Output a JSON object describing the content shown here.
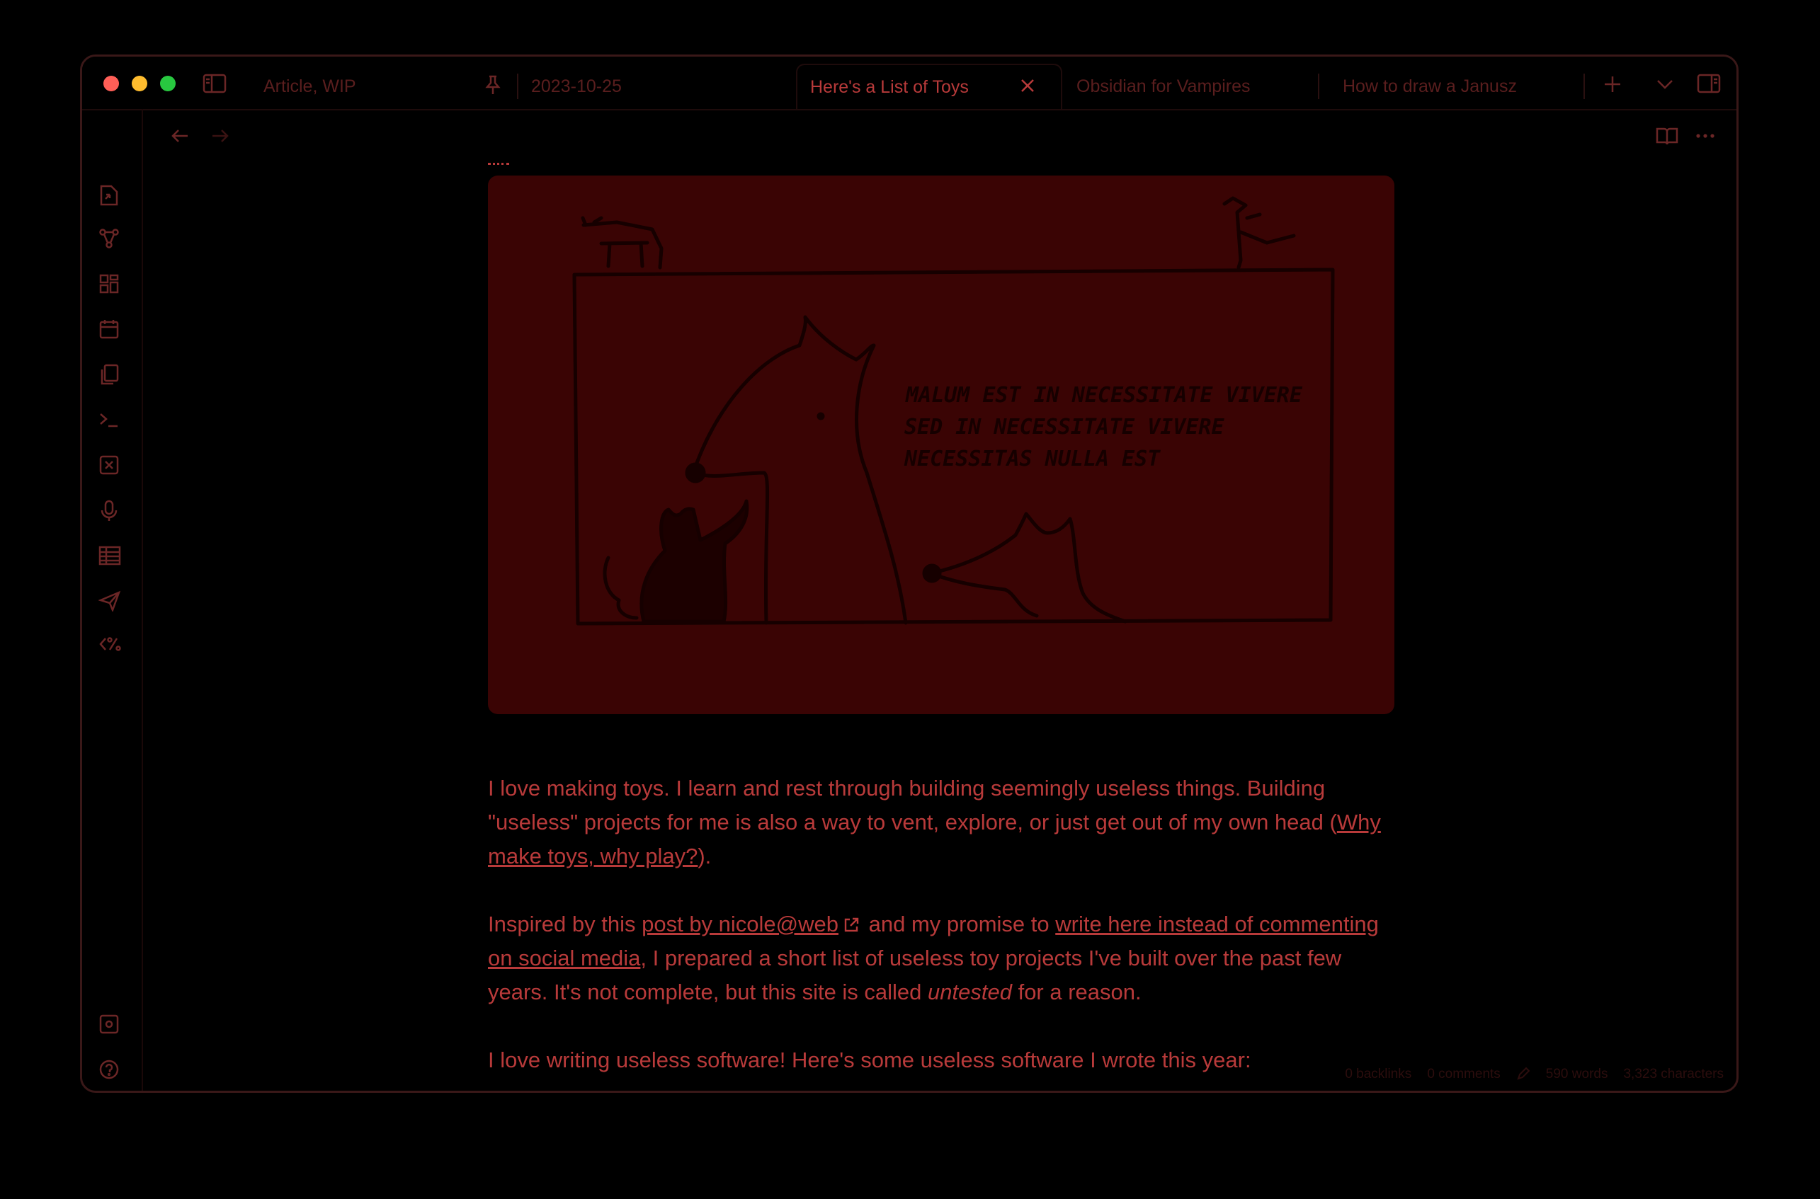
{
  "tabs": [
    {
      "label": "Article, WIP",
      "pinned": true
    },
    {
      "label": "2023-10-25"
    },
    {
      "label": "Here's a List of Toys",
      "active": true
    },
    {
      "label": "Obsidian for Vampires"
    },
    {
      "label": "How to draw a Janusz"
    }
  ],
  "illustration": {
    "caption_lines": [
      "MALUM EST IN NECESSITATE VIVERE",
      "SED IN NECESSITATE VIVERE",
      "NECESSITAS NULLA EST"
    ]
  },
  "body": {
    "p1_text": "I love making toys. I learn and rest through building seemingly useless things. Building \"useless\" projects for me is also a way to vent, explore, or just get out of my own head (",
    "p1_link": "Why make toys, why play?",
    "p1_end": ").",
    "p2_start": "Inspired by this ",
    "p2_link1": "post by nicole@web",
    "p2_mid": " and my promise to ",
    "p2_link2": "write here instead of commenting on social media",
    "p2_rest": ", I prepared a short list of useless toy projects I've built over the past few years. It's not complete, but this site is called ",
    "p2_em": "untested",
    "p2_end": " for a reason.",
    "p3": "I love writing useless software! Here's some useless software I wrote this year:"
  },
  "status_bar": [
    "0 backlinks",
    "0 comments",
    "590 words",
    "3,323 characters"
  ],
  "colors": {
    "accent": "#b83a3a",
    "image_bg": "#3a0404",
    "background": "#000000"
  }
}
